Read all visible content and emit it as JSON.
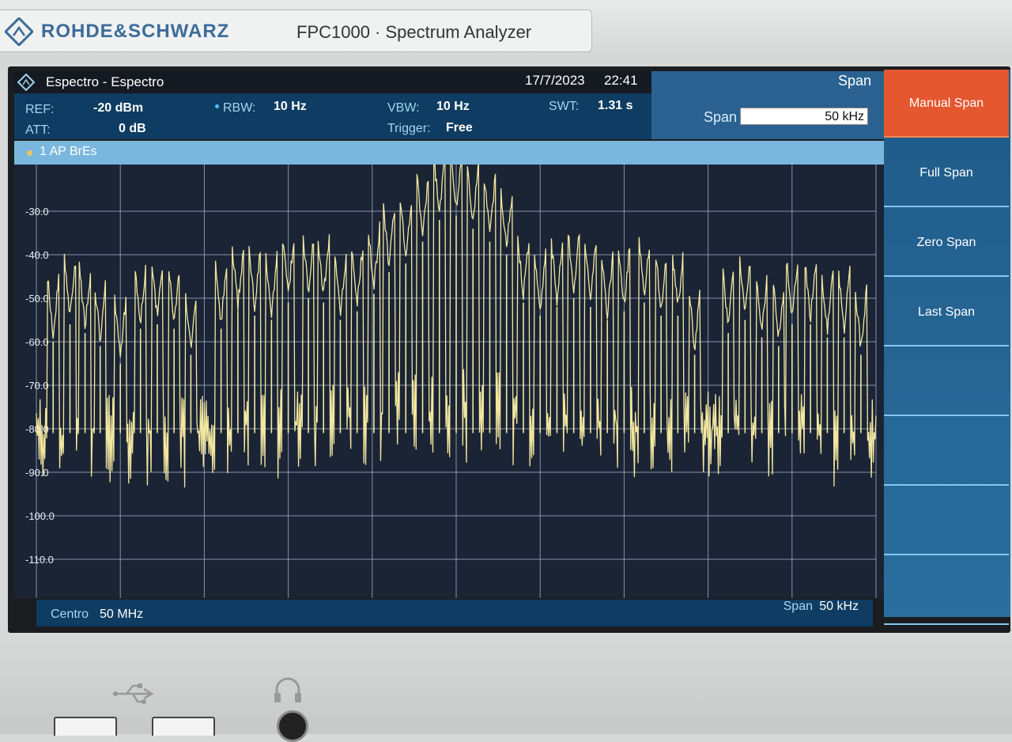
{
  "device": {
    "brand": "ROHDE&SCHWARZ",
    "model": "FPC1000 · Spectrum Analyzer"
  },
  "header": {
    "title": "Espectro - Espectro",
    "date": "17/7/2023",
    "time": "22:41"
  },
  "settings": {
    "ref_label": "REF:",
    "ref_value": "-20 dBm",
    "att_label": "ATT:",
    "att_value": "0 dB",
    "rbw_label": "RBW:",
    "rbw_value": "10 Hz",
    "vbw_label": "VBW:",
    "vbw_value": "10 Hz",
    "trigger_label": "Trigger:",
    "trigger_value": "Free",
    "swt_label": "SWT:",
    "swt_value": "1.31 s"
  },
  "span_panel": {
    "heading": "Span",
    "field_label": "Span",
    "field_value": "50 kHz"
  },
  "trace": {
    "label": "1 AP  BrEs"
  },
  "footer": {
    "center_label": "Centro",
    "center_value": "50 MHz",
    "span_label": "Span",
    "span_value": "50 kHz"
  },
  "softkeys": [
    {
      "label": "Manual Span",
      "active": true
    },
    {
      "label": "Full Span",
      "active": false
    },
    {
      "label": "Zero Span",
      "active": false
    },
    {
      "label": "Last Span",
      "active": false
    },
    {
      "label": "",
      "active": false
    },
    {
      "label": "",
      "active": false
    },
    {
      "label": "",
      "active": false
    },
    {
      "label": "",
      "active": false
    }
  ],
  "colors": {
    "trace": "#f3e7a0",
    "grid": "#a9b8cc",
    "plot_bg": "#1a2435",
    "active_softkey": "#e5572f"
  },
  "chart_data": {
    "type": "line",
    "ytick_labels": [
      "-30.0",
      "-40.0",
      "-50.0",
      "-60.0",
      "-70.0",
      "-80.0",
      "-90.0",
      "-100.0",
      "-110.0"
    ],
    "ylim": [
      -120,
      -20
    ],
    "xlim": [
      -25,
      25
    ],
    "grid": true,
    "peaks_x": [
      -24.0,
      -23.0,
      -22.1,
      -21.2,
      -20.0,
      -18.8,
      -17.8,
      -16.8,
      -15.8,
      -14.0,
      -13.0,
      -12.0,
      -11.0,
      -10.0,
      -8.8,
      -7.9,
      -6.9,
      -5.9,
      -4.9,
      -4.0,
      -3.0,
      -2.0,
      -1.0,
      0.0,
      1.0,
      2.0,
      3.0,
      4.0,
      5.0,
      6.0,
      7.0,
      8.0,
      9.0,
      10.0,
      11.2,
      12.2,
      13.2,
      14.2,
      16.2,
      17.2,
      18.2,
      19.2,
      20.0,
      21.1,
      22.1,
      23.1,
      24.1
    ],
    "peaks_y": [
      -60,
      -56,
      -58,
      -61,
      -65,
      -57,
      -56,
      -57,
      -63,
      -57,
      -53,
      -54,
      -55,
      -51,
      -50,
      -51,
      -55,
      -53,
      -49,
      -44,
      -42,
      -37,
      -32,
      -31,
      -34,
      -37,
      -40,
      -51,
      -54,
      -52,
      -50,
      -52,
      -55,
      -53,
      -51,
      -54,
      -54,
      -63,
      -58,
      -55,
      -59,
      -61,
      -56,
      -56,
      -59,
      -59,
      -63
    ],
    "noise_floor_dbm": -83
  }
}
